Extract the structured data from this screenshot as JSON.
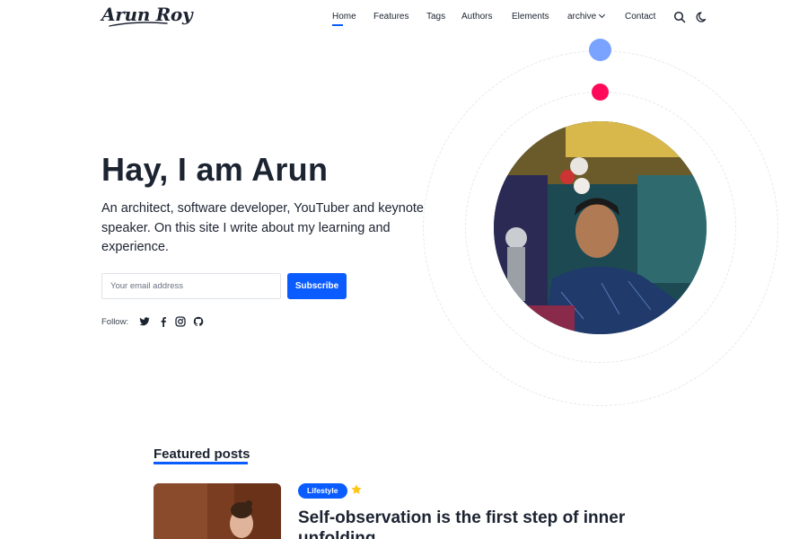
{
  "header": {
    "logo": "Arun Roy",
    "nav": [
      {
        "label": "Home",
        "active": true
      },
      {
        "label": "Features"
      },
      {
        "label": "Tags"
      },
      {
        "label": "Authors"
      },
      {
        "label": "Elements"
      },
      {
        "label": "archive"
      },
      {
        "label": "Contact"
      }
    ],
    "icons": [
      "search-icon",
      "moon-icon"
    ]
  },
  "hero": {
    "title": "Hay, I am Arun",
    "description": "An architect, software developer, YouTuber and keynote speaker. On this site I write about my learning and experience.",
    "email_placeholder": "Your email address",
    "subscribe_label": "Subscribe",
    "follow_label": "Follow:",
    "social_icons": [
      "twitter-icon",
      "facebook-icon",
      "instagram-icon",
      "github-icon"
    ]
  },
  "featured": {
    "heading": "Featured posts",
    "posts": [
      {
        "tag": "Lifestyle",
        "title": "Self-observation is the first step of inner unfolding"
      }
    ]
  },
  "colors": {
    "accent": "#0b5cff",
    "dot_blue": "#7aa2ff",
    "dot_red": "#ff0a5a",
    "text": "#1c2331"
  }
}
